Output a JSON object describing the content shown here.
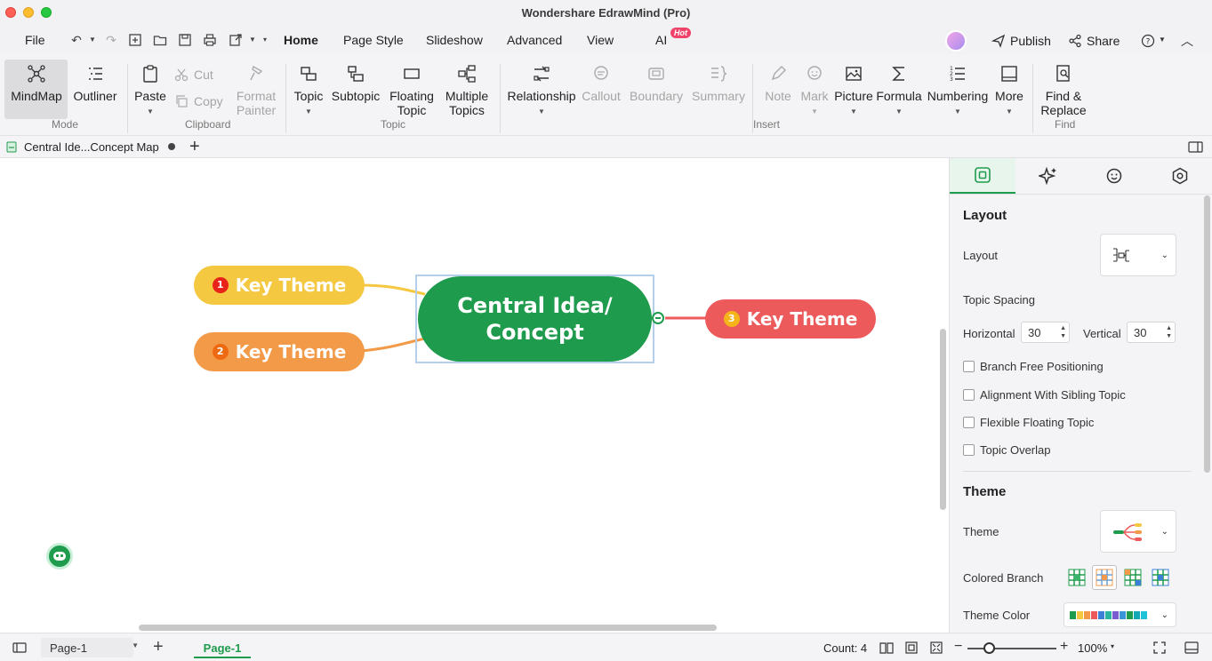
{
  "window": {
    "title": "Wondershare EdrawMind (Pro)"
  },
  "menu": {
    "file": "File",
    "tabs": [
      "Home",
      "Page Style",
      "Slideshow",
      "Advanced",
      "View",
      "AI"
    ],
    "active_tab": "Home",
    "ai_badge": "Hot",
    "publish": "Publish",
    "share": "Share"
  },
  "ribbon": {
    "mode": {
      "mindmap": "MindMap",
      "outliner": "Outliner",
      "label": "Mode"
    },
    "clipboard": {
      "paste": "Paste",
      "cut": "Cut",
      "copy": "Copy",
      "format_painter_1": "Format",
      "format_painter_2": "Painter",
      "label": "Clipboard"
    },
    "topic": {
      "topic": "Topic",
      "subtopic": "Subtopic",
      "floating_1": "Floating",
      "floating_2": "Topic",
      "multiple_1": "Multiple",
      "multiple_2": "Topics",
      "label": "Topic"
    },
    "insert": {
      "relationship": "Relationship",
      "callout": "Callout",
      "boundary": "Boundary",
      "summary": "Summary",
      "note": "Note",
      "mark": "Mark",
      "picture": "Picture",
      "formula": "Formula",
      "numbering": "Numbering",
      "more": "More",
      "label": "Insert"
    },
    "find": {
      "find_1": "Find &",
      "find_2": "Replace",
      "label": "Find"
    }
  },
  "doc_tab": {
    "name": "Central Ide...Concept Map"
  },
  "mindmap": {
    "central_line1": "Central Idea/",
    "central_line2": "Concept",
    "topics": [
      {
        "num": "1",
        "label": "Key Theme",
        "color": "#f5c842"
      },
      {
        "num": "2",
        "label": "Key Theme",
        "color": "#f29a48"
      },
      {
        "num": "3",
        "label": "Key Theme",
        "color": "#ec5a5c"
      }
    ],
    "central_color": "#1f9b4d"
  },
  "panel": {
    "layout_heading": "Layout",
    "layout_label": "Layout",
    "topic_spacing": "Topic Spacing",
    "horizontal_label": "Horizontal",
    "horizontal_value": "30",
    "vertical_label": "Vertical",
    "vertical_value": "30",
    "checkboxes": [
      "Branch Free Positioning",
      "Alignment With Sibling Topic",
      "Flexible Floating Topic",
      "Topic Overlap"
    ],
    "theme_heading": "Theme",
    "theme_label": "Theme",
    "colored_branch_label": "Colored Branch",
    "theme_color_label": "Theme Color"
  },
  "status": {
    "page_select": "Page-1",
    "page_tab": "Page-1",
    "count": "Count: 4",
    "zoom": "100%"
  }
}
